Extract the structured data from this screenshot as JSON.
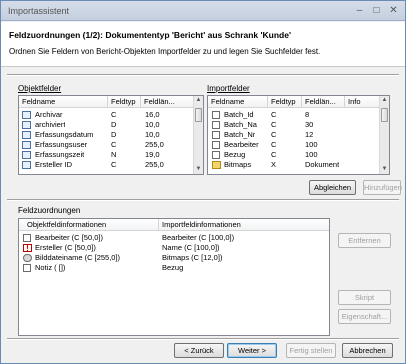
{
  "window": {
    "title": "Importassistent",
    "min_glyph": "–",
    "max_glyph": "□",
    "close_glyph": "✕"
  },
  "header": {
    "title": "Feldzuordnungen (1/2): Dokumententyp 'Bericht' aus Schrank 'Kunde'",
    "description": "Ordnen Sie Feldern von Bericht-Objekten Importfelder zu und legen Sie Suchfelder fest."
  },
  "object_fields": {
    "label": "Objektfelder",
    "columns": [
      "Feldname",
      "Feldtyp",
      "Feldlän..."
    ],
    "rows": [
      {
        "name": "Archivar",
        "type": "C",
        "length": "16,0"
      },
      {
        "name": "archiviert",
        "type": "D",
        "length": "10,0"
      },
      {
        "name": "Erfassungsdatum",
        "type": "D",
        "length": "10,0"
      },
      {
        "name": "Erfassungsuser",
        "type": "C",
        "length": "255,0"
      },
      {
        "name": "Erfassungszeit",
        "type": "N",
        "length": "19,0"
      },
      {
        "name": "Ersteller ID",
        "type": "C",
        "length": "255,0"
      }
    ]
  },
  "import_fields": {
    "label": "Importfelder",
    "columns": [
      "Feldname",
      "Feldtyp",
      "Feldlän...",
      "Info"
    ],
    "rows": [
      {
        "name": "Batch_Id",
        "type": "C",
        "length": "8",
        "info": ""
      },
      {
        "name": "Batch_Na",
        "type": "C",
        "length": "30",
        "info": ""
      },
      {
        "name": "Batch_Nr",
        "type": "C",
        "length": "12",
        "info": ""
      },
      {
        "name": "Bearbeiter",
        "type": "C",
        "length": "100",
        "info": ""
      },
      {
        "name": "Bezug",
        "type": "C",
        "length": "100",
        "info": ""
      },
      {
        "name": "Bitmaps",
        "type": "X",
        "length": "Dokument",
        "info": ""
      }
    ]
  },
  "buttons": {
    "match": "Abgleichen",
    "add": "Hinzufügen",
    "remove": "Entfernen",
    "script": "Skript",
    "properties": "Eigenschaft...",
    "back": "< Zurück",
    "next": "Weiter >",
    "finish": "Fertig stellen",
    "cancel": "Abbrechen"
  },
  "assignments": {
    "label": "Feldzuordnungen",
    "columns": [
      "Objektfeldinformationen",
      "Importfeldinformationen"
    ],
    "rows": [
      {
        "icon": "checkbox-icon",
        "object": "Bearbeiter (C [50,0])",
        "import": "Bearbeiter (C [100,0])"
      },
      {
        "icon": "required-icon",
        "object": "Ersteller (C [50,0])",
        "import": "Name (C [100,0])"
      },
      {
        "icon": "image-field-icon",
        "object": "Bilddateiname (C [255,0])",
        "import": "Bitmaps (C [12,0])"
      },
      {
        "icon": "checkbox-icon",
        "object": "Notiz ( [])",
        "import": "Bezug"
      }
    ]
  }
}
